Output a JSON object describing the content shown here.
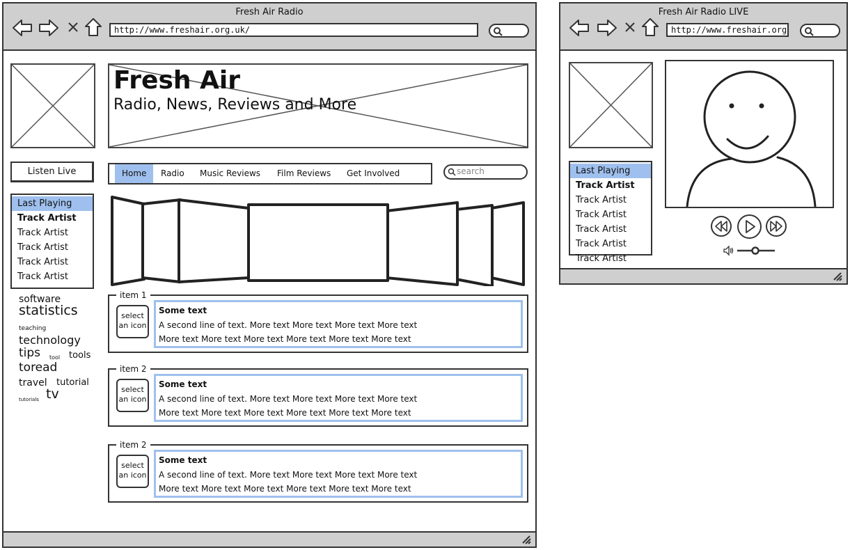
{
  "main_window": {
    "title": "Fresh Air Radio",
    "url": "http://www.freshair.org.uk/",
    "logo_title": "Fresh Air",
    "logo_subtitle": "Radio, News, Reviews and More",
    "listen_live_label": "Listen Live",
    "playlist": {
      "header": "Last Playing",
      "items": [
        "Track Artist",
        "Track Artist",
        "Track Artist",
        "Track Artist",
        "Track Artist"
      ]
    },
    "tag_cloud": [
      "software",
      "statistics",
      "teaching",
      "technology",
      "tips",
      "tool",
      "tools",
      "toread",
      "travel",
      "tutorial",
      "tutorials",
      "tv"
    ],
    "nav": {
      "items": [
        "Home",
        "Radio",
        "Music Reviews",
        "Film Reviews",
        "Get Involved"
      ],
      "active": "Home"
    },
    "search_placeholder": "search",
    "content_items": [
      {
        "legend": "item 1",
        "icon_label": "select an icon",
        "line1": "Some text",
        "line2": "A second line of text. More text More text More text More text",
        "line3": "More text More text More text More text More text More text"
      },
      {
        "legend": "item 2",
        "icon_label": "select an icon",
        "line1": "Some text",
        "line2": "A second line of text. More text More text More text More text",
        "line3": "More text More text More text More text More text More text"
      },
      {
        "legend": "item 2",
        "icon_label": "select an icon",
        "line1": "Some text",
        "line2": "A second line of text. More text More text More text More text",
        "line3": "More text More text More text More text More text More text"
      }
    ]
  },
  "live_window": {
    "title": "Fresh Air Radio LIVE",
    "url": "http://www.freshair.org.uk/",
    "playlist": {
      "header": "Last Playing",
      "items": [
        "Track Artist",
        "Track Artist",
        "Track Artist",
        "Track Artist",
        "Track Artist",
        "Track Artist"
      ]
    },
    "media_controls": [
      "rewind-icon",
      "play-icon",
      "fast-forward-icon"
    ],
    "volume_icon": "volume-icon"
  },
  "colors": {
    "chrome": "#cfcfcf",
    "selection": "#9fc0ee",
    "outline": "#333333"
  }
}
